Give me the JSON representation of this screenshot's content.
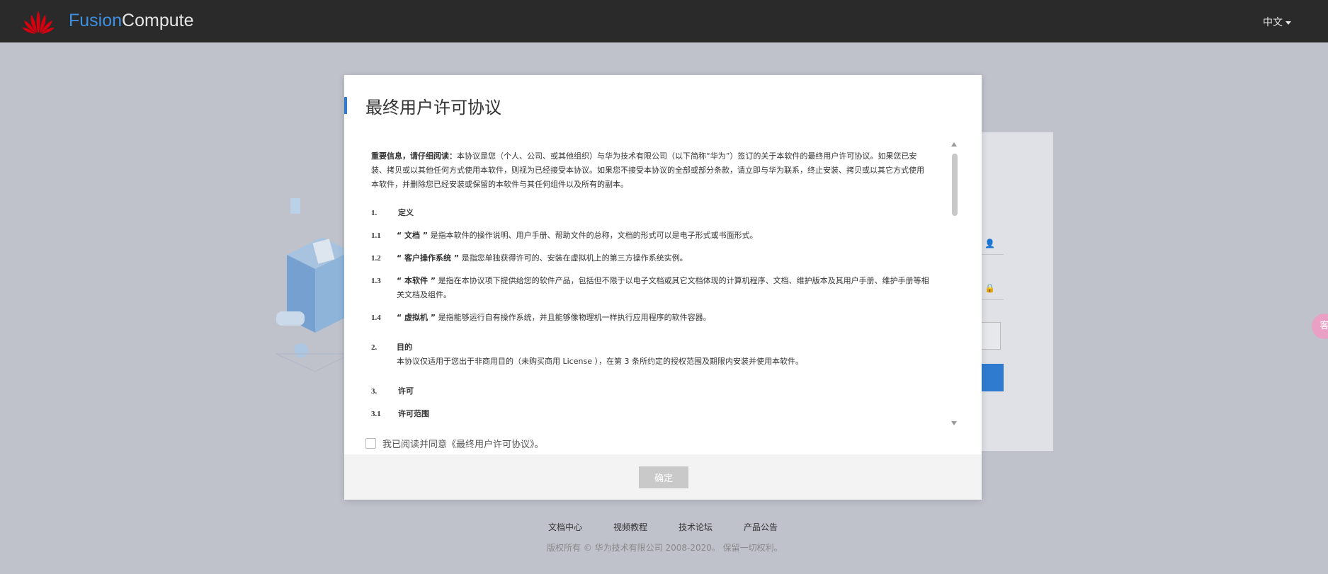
{
  "header": {
    "brand_part1": "Fusion",
    "brand_part2": "Compute",
    "language": "中文",
    "logo_icon": "huawei-logo-icon"
  },
  "modal": {
    "title": "最终用户许可协议",
    "intro_bold": "重要信息，请仔细阅读：",
    "intro_text": "本协议是您（个人、公司、或其他组织）与华为技术有限公司（以下简称“华为”）签订的关于本软件的最终用户许可协议。如果您已安装、拷贝或以其他任何方式使用本软件，则视为已经接受本协议。如果您不接受本协议的全部或部分条款，请立即与华为联系，终止安装、拷贝或以其它方式使用本软件，并删除您已经安装或保留的本软件与其任何组件以及所有的副本。",
    "sections": [
      {
        "num": "1.",
        "title": "定义",
        "items": [
          {
            "num": "1.1",
            "term": "“ 文档 ”",
            "text": "是指本软件的操作说明、用户手册、帮助文件的总称，文档的形式可以是电子形式或书面形式。"
          },
          {
            "num": "1.2",
            "term": "“ 客户操作系统 ”",
            "text": "是指您单独获得许可的、安装在虚拟机上的第三方操作系统实例。"
          },
          {
            "num": "1.3",
            "term": "“ 本软件 ”",
            "text": "是指在本协议项下提供给您的软件产品，包括但不限于以电子文档或其它文档体现的计算机程序、文档、维护版本及其用户手册、维护手册等相关文档及组件。"
          },
          {
            "num": "1.4",
            "term": "“ 虚拟机 ”",
            "text": "是指能够运行自有操作系统，并且能够像物理机一样执行应用程序的软件容器。"
          }
        ]
      }
    ],
    "goal": {
      "num": "2.",
      "title": "目的",
      "text": "本协议仅适用于您出于非商用目的（未购买商用 License ），在第 3 条所约定的授权范围及期限内安装并使用本软件。"
    },
    "license": {
      "num": "3.",
      "title": "许可",
      "sub_num": "3.1",
      "sub_title": "许可范围"
    },
    "agree_label": "我已阅读并同意《最终用户许可协议》。",
    "confirm_label": "确定"
  },
  "footer": {
    "links": [
      "文档中心",
      "视频教程",
      "技术论坛",
      "产品公告"
    ],
    "copyright": "版权所有 © 华为技术有限公司 2008-2020。 保留一切权利。"
  },
  "side_chat": "客"
}
